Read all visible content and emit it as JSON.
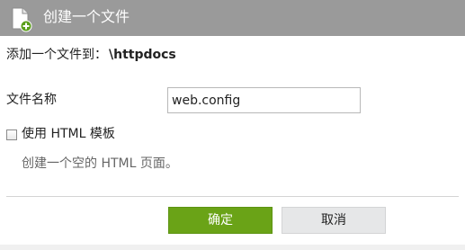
{
  "dialog": {
    "title": "创建一个文件",
    "title_icon": "new-file-icon",
    "subtitle_prefix": "添加一个文件到：",
    "target_path": "\\httpdocs",
    "file_name_label": "文件名称",
    "file_name_value": "web.config",
    "template_checkbox_label": "使用 HTML 模板",
    "template_checked": false,
    "template_hint": "创建一个空的 HTML 页面。",
    "ok_label": "确定",
    "cancel_label": "取消"
  },
  "colors": {
    "titlebar": "#9a9a9a",
    "ok_button": "#6aa317",
    "cancel_button": "#e6e7e8",
    "icon_plus": "#5a9e1a"
  }
}
